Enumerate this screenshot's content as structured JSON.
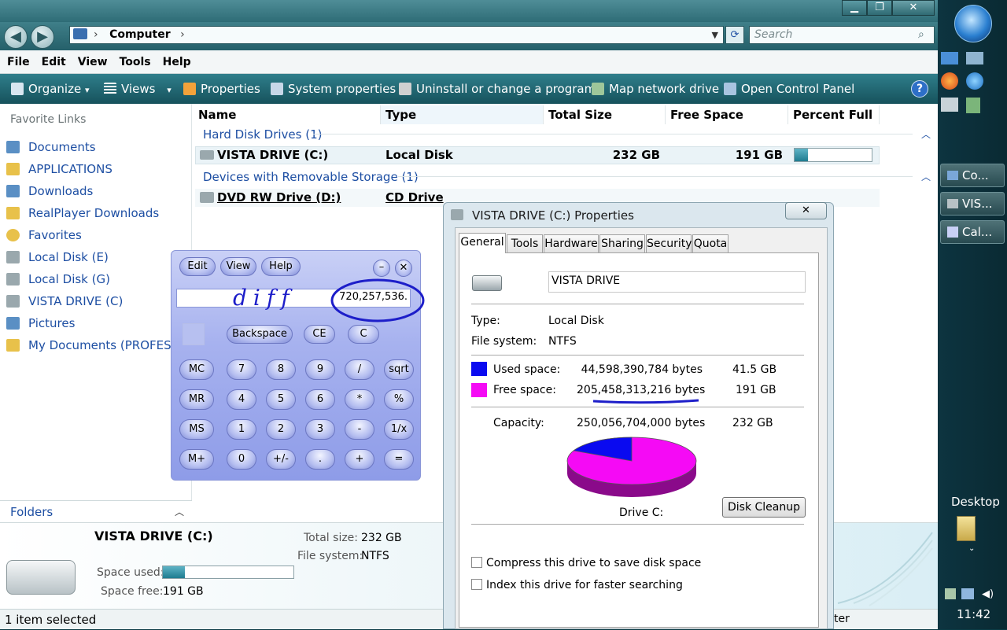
{
  "window": {
    "address_path": "Computer",
    "search_placeholder": "Search",
    "caption_min": "▁",
    "caption_max": "❐",
    "caption_close": "✕"
  },
  "menu": [
    "File",
    "Edit",
    "View",
    "Tools",
    "Help"
  ],
  "toolbar": [
    "Organize",
    "Views",
    "Properties",
    "System properties",
    "Uninstall or change a program",
    "Map network drive",
    "Open Control Panel"
  ],
  "toolbar_arrow": "▾",
  "help_glyph": "?",
  "nav": {
    "back": "◀",
    "forward": "▶"
  },
  "favorites_title": "Favorite Links",
  "favorites": [
    "Documents",
    "APPLICATIONS",
    "Downloads",
    "RealPlayer Downloads",
    "Favorites",
    "Local Disk (E)",
    "Local Disk (G)",
    "VISTA DRIVE (C)",
    "Pictures",
    "My Documents (PROFESSIO"
  ],
  "folders_label": "Folders",
  "columns": [
    "Name",
    "Type",
    "Total Size",
    "Free Space",
    "Percent Full"
  ],
  "groups": [
    {
      "label": "Hard Disk Drives (1)",
      "items": [
        {
          "name": "VISTA DRIVE (C:)",
          "type": "Local Disk",
          "total": "232 GB",
          "free": "191 GB",
          "percent_full": 0.17
        }
      ]
    },
    {
      "label": "Devices with Removable Storage (1)",
      "items": [
        {
          "name": "DVD RW Drive (D:)",
          "type": "CD Drive"
        }
      ]
    }
  ],
  "details": {
    "name": "VISTA DRIVE (C:)",
    "space_used_label": "Space used:",
    "space_free_label": "Space free:",
    "space_free": "191 GB",
    "total_size_label": "Total size:",
    "total_size": "232 GB",
    "fs_label": "File system:",
    "fs": "NTFS",
    "used_fraction": 0.17
  },
  "status": {
    "text": "1 item selected",
    "right_fragment": "ter"
  },
  "calculator": {
    "menu": [
      "Edit",
      "View",
      "Help"
    ],
    "display": "720,257,536.",
    "annotation": "diff",
    "row1": [
      "Backspace",
      "CE",
      "C"
    ],
    "keys": [
      [
        "MC",
        "7",
        "8",
        "9",
        "/",
        "sqrt"
      ],
      [
        "MR",
        "4",
        "5",
        "6",
        "*",
        "%"
      ],
      [
        "MS",
        "1",
        "2",
        "3",
        "-",
        "1/x"
      ],
      [
        "M+",
        "0",
        "+/-",
        ".",
        "+",
        "="
      ]
    ]
  },
  "properties": {
    "title": "VISTA DRIVE (C:) Properties",
    "tabs": [
      "General",
      "Tools",
      "Hardware",
      "Sharing",
      "Security",
      "Quota"
    ],
    "label_value": "VISTA DRIVE",
    "type_label": "Type:",
    "type": "Local Disk",
    "fs_label": "File system:",
    "fs": "NTFS",
    "used_label": "Used space:",
    "used_bytes": "44,598,390,784 bytes",
    "used_gb": "41.5 GB",
    "free_label": "Free space:",
    "free_bytes": "205,458,313,216 bytes",
    "free_gb": "191 GB",
    "capacity_label": "Capacity:",
    "capacity_bytes": "250,056,704,000 bytes",
    "capacity_gb": "232 GB",
    "drive_label": "Drive C:",
    "cleanup": "Disk Cleanup",
    "compress": "Compress this drive to save disk space",
    "index": "Index this drive for faster searching",
    "colors": {
      "used": "#0a0af0",
      "free": "#f50af5"
    }
  },
  "sidebar": {
    "tasks": [
      "Co...",
      "VIS...",
      "Cal..."
    ],
    "desktop": "Desktop",
    "clock": "11:42"
  }
}
